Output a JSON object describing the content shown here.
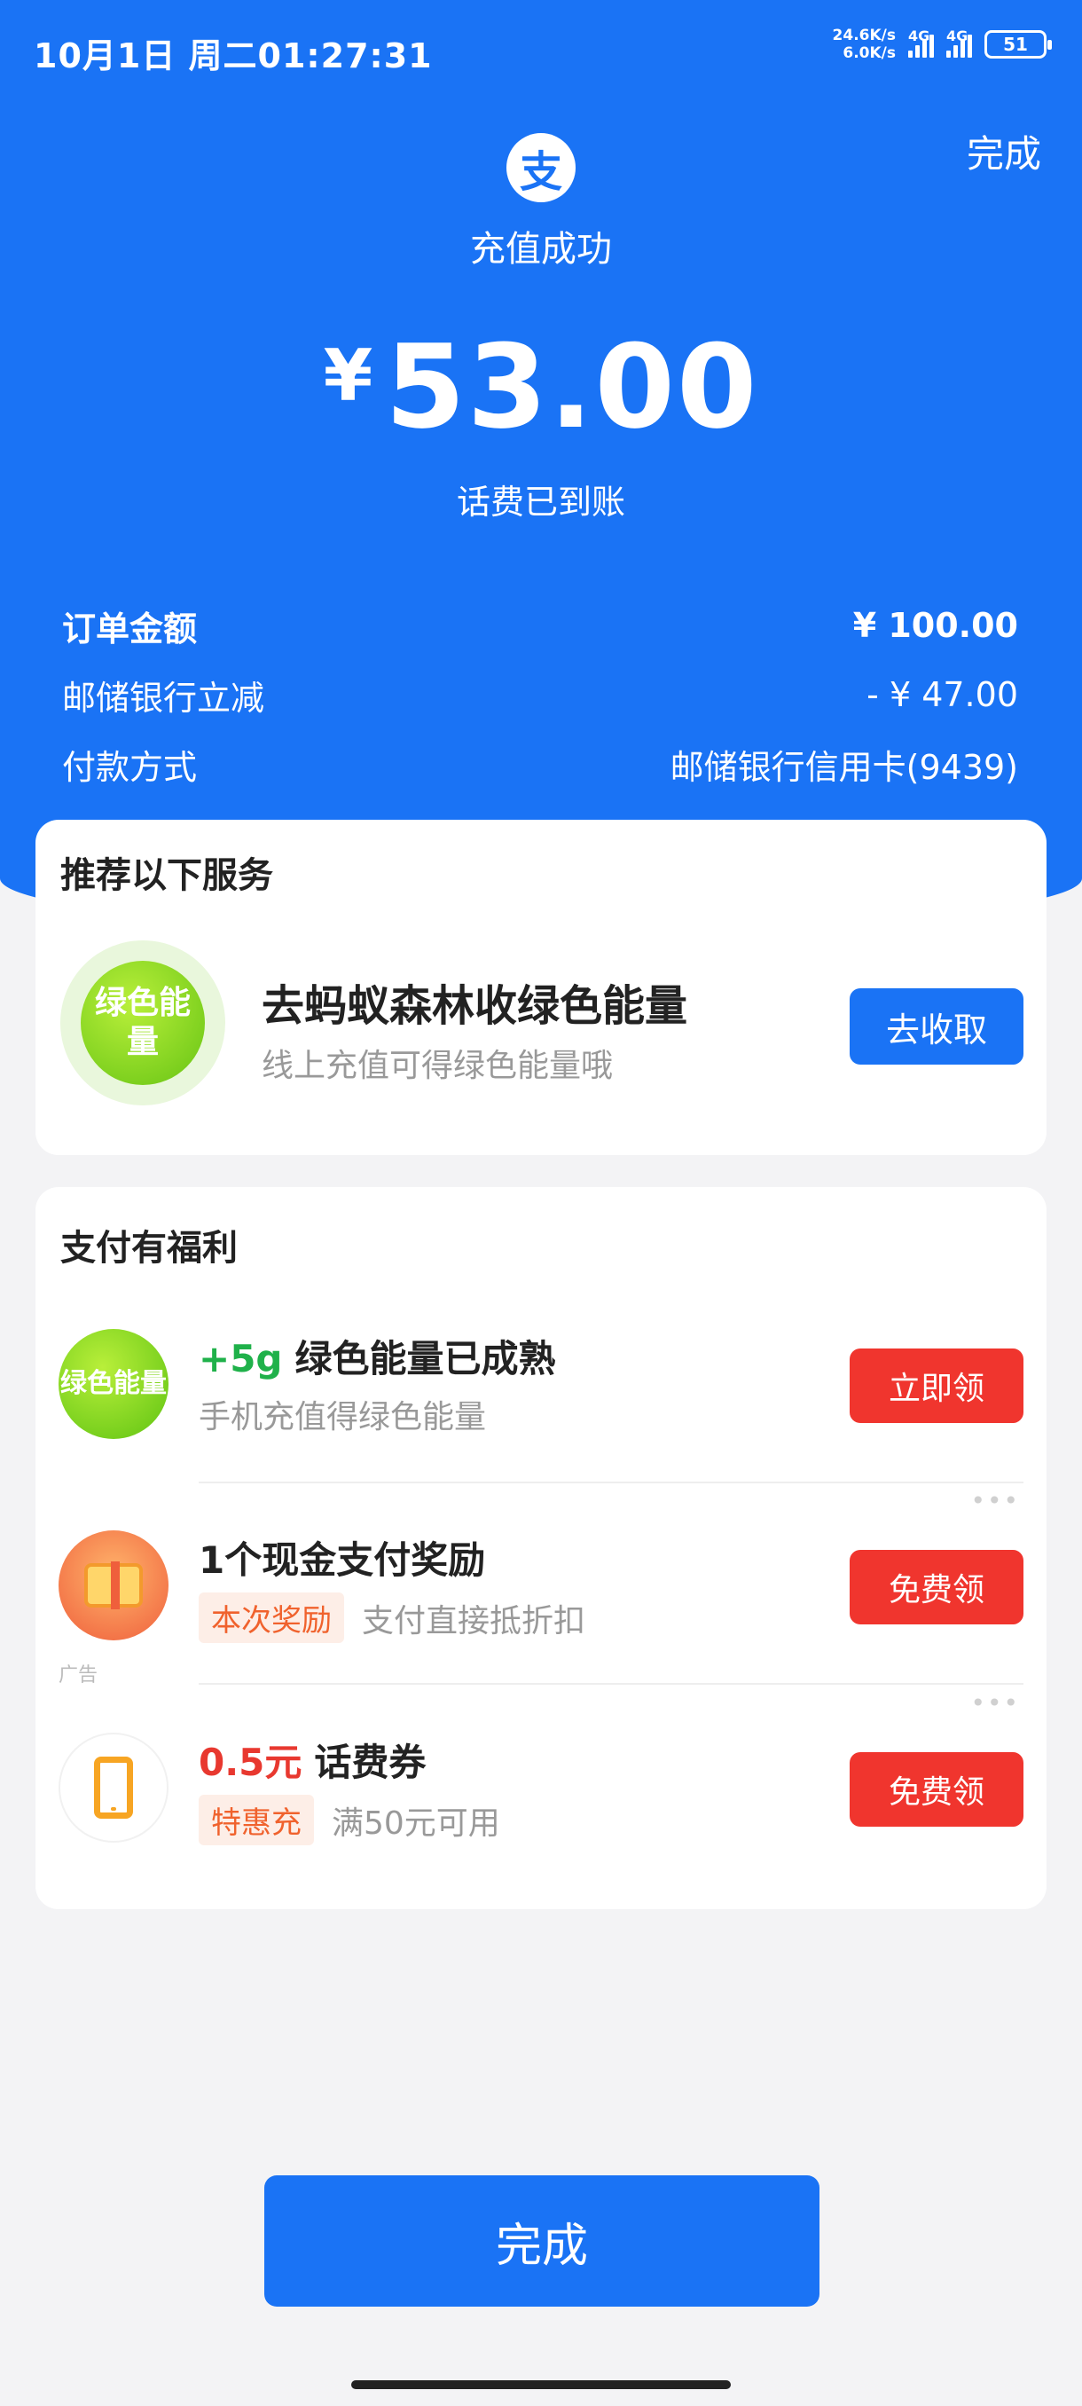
{
  "status_bar": {
    "datetime": "10月1日 周二01:27:31",
    "net_up": "24.6K/s",
    "net_down": "6.0K/s",
    "net1": "4G",
    "net2": "4G",
    "battery": "51"
  },
  "header": {
    "done_label": "完成",
    "logo_char": "支",
    "title": "充值成功",
    "currency": "¥",
    "amount": "53.00",
    "subtitle": "话费已到账"
  },
  "details": [
    {
      "label": "订单金额",
      "value": "¥ 100.00"
    },
    {
      "label": "邮储银行立减",
      "value": "- ¥ 47.00"
    },
    {
      "label": "付款方式",
      "value": "邮储银行信用卡(9439)"
    }
  ],
  "recommend": {
    "title": "推荐以下服务",
    "icon_text": "绿色能量",
    "service_title": "去蚂蚁森林收绿色能量",
    "service_sub": "线上充值可得绿色能量哦",
    "button": "去收取"
  },
  "benefits": {
    "title": "支付有福利",
    "items": [
      {
        "icon": "green-energy-icon",
        "icon_text": "绿色能量",
        "highlight": "+5g",
        "title": "绿色能量已成熟",
        "sub": "手机充值得绿色能量",
        "button": "立即领"
      },
      {
        "icon": "gift-box-icon",
        "title": "1个现金支付奖励",
        "tag": "本次奖励",
        "sub": "支付直接抵折扣",
        "button": "免费领",
        "ad": "广告"
      },
      {
        "icon": "phone-icon",
        "highlight": "0.5元",
        "title": "话费券",
        "tag": "特惠充",
        "sub": "满50元可用",
        "button": "免费领"
      }
    ]
  },
  "footer": {
    "done_label": "完成"
  },
  "colors": {
    "primary": "#1a73f5",
    "danger": "#f0352e",
    "green": "#1fb14a"
  }
}
